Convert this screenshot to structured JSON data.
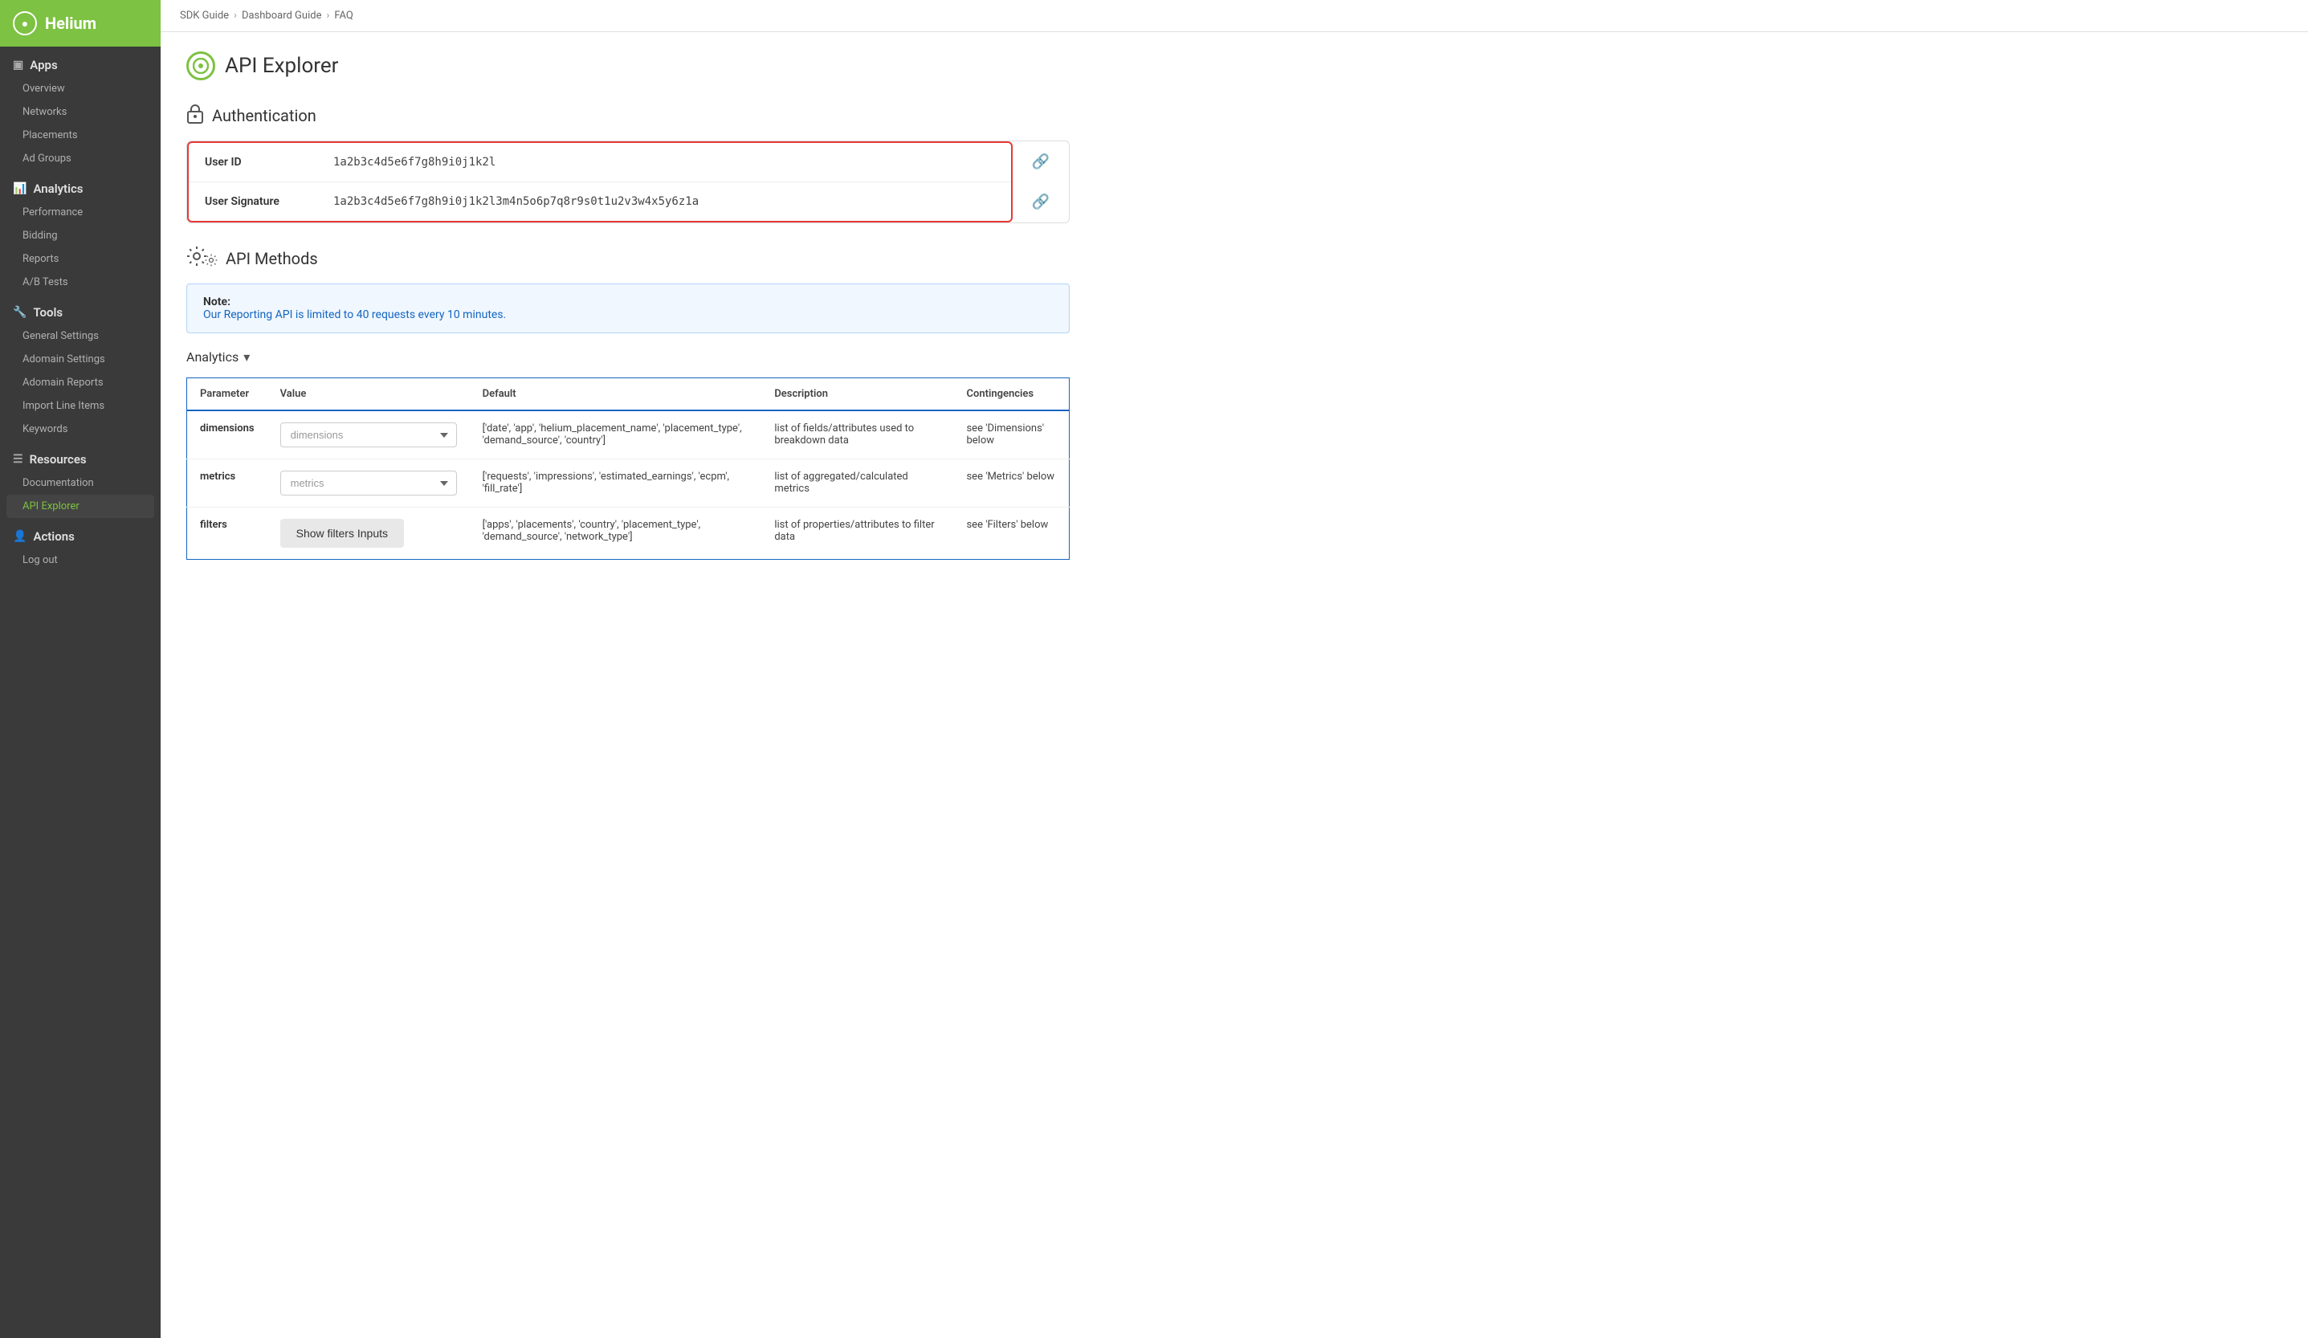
{
  "app": {
    "name": "Helium"
  },
  "breadcrumb": {
    "items": [
      "SDK Guide",
      "Dashboard Guide",
      "FAQ"
    ]
  },
  "sidebar": {
    "sections": [
      {
        "id": "apps",
        "label": "Apps",
        "icon": "📱",
        "items": [
          "Overview",
          "Networks",
          "Placements",
          "Ad Groups"
        ]
      },
      {
        "id": "analytics",
        "label": "Analytics",
        "icon": "📊",
        "items": [
          "Performance",
          "Bidding",
          "Reports",
          "A/B Tests"
        ]
      },
      {
        "id": "tools",
        "label": "Tools",
        "icon": "🔧",
        "items": [
          "General Settings",
          "Adomain Settings",
          "Adomain Reports",
          "Import Line Items",
          "Keywords"
        ]
      },
      {
        "id": "resources",
        "label": "Resources",
        "icon": "≡",
        "items": [
          "Documentation",
          "API Explorer"
        ]
      },
      {
        "id": "actions",
        "label": "Actions",
        "icon": "👤",
        "items": [
          "Log out"
        ]
      }
    ],
    "active_item": "API Explorer"
  },
  "page": {
    "title": "API Explorer",
    "sections": {
      "authentication": {
        "title": "Authentication",
        "fields": [
          {
            "label": "User ID",
            "value": "1a2b3c4d5e6f7g8h9i0j1k2l"
          },
          {
            "label": "User Signature",
            "value": "1a2b3c4d5e6f7g8h9i0j1k2l3m4n5o6p7q8r9s0t1u2v3w4x5y6z1a"
          }
        ]
      },
      "api_methods": {
        "title": "API Methods",
        "note_label": "Note:",
        "note_text": "Our Reporting API is limited to 40 requests every 10 minutes.",
        "analytics_label": "Analytics",
        "table": {
          "headers": [
            "Parameter",
            "Value",
            "Default",
            "Description",
            "Contingencies"
          ],
          "rows": [
            {
              "parameter": "dimensions",
              "value_placeholder": "dimensions",
              "default": "['date', 'app', 'helium_placement_name', 'placement_type', 'demand_source', 'country']",
              "description": "list of fields/attributes used to breakdown data",
              "contingencies": "see 'Dimensions' below"
            },
            {
              "parameter": "metrics",
              "value_placeholder": "metrics",
              "default": "['requests', 'impressions', 'estimated_earnings', 'ecpm', 'fill_rate']",
              "description": "list of aggregated/calculated metrics",
              "contingencies": "see 'Metrics' below"
            },
            {
              "parameter": "filters",
              "value_placeholder": "",
              "value_button": "Show filters Inputs",
              "default": "['apps', 'placements', 'country', 'placement_type', 'demand_source', 'network_type']",
              "description": "list of properties/attributes to filter data",
              "contingencies": "see 'Filters' below"
            }
          ]
        }
      }
    }
  }
}
